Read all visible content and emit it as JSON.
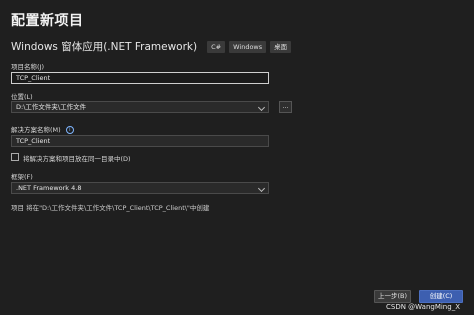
{
  "window": {
    "title": "配置新项目"
  },
  "template": {
    "name": "Windows 窗体应用(.NET Framework)",
    "tags": [
      "C#",
      "Windows",
      "桌面"
    ]
  },
  "form": {
    "project_name_label": "项目名称(J)",
    "project_name_value": "TCP_Client",
    "location_label": "位置(L)",
    "location_value": "D:\\工作文件夹\\工作文件",
    "browse_label": "...",
    "solution_name_label": "解决方案名称(M)",
    "solution_name_value": "TCP_Client",
    "same_dir_label": "将解决方案和项目放在同一目录中(D)",
    "same_dir_checked": false,
    "framework_label": "框架(F)",
    "framework_value": ".NET Framework 4.8"
  },
  "summary": "项目 将在\"D:\\工作文件夹\\工作文件\\TCP_Client\\TCP_Client\\\"中创建",
  "buttons": {
    "back": "上一步(B)",
    "create": "创建(C)"
  },
  "watermark": "CSDN @WangMing_X"
}
